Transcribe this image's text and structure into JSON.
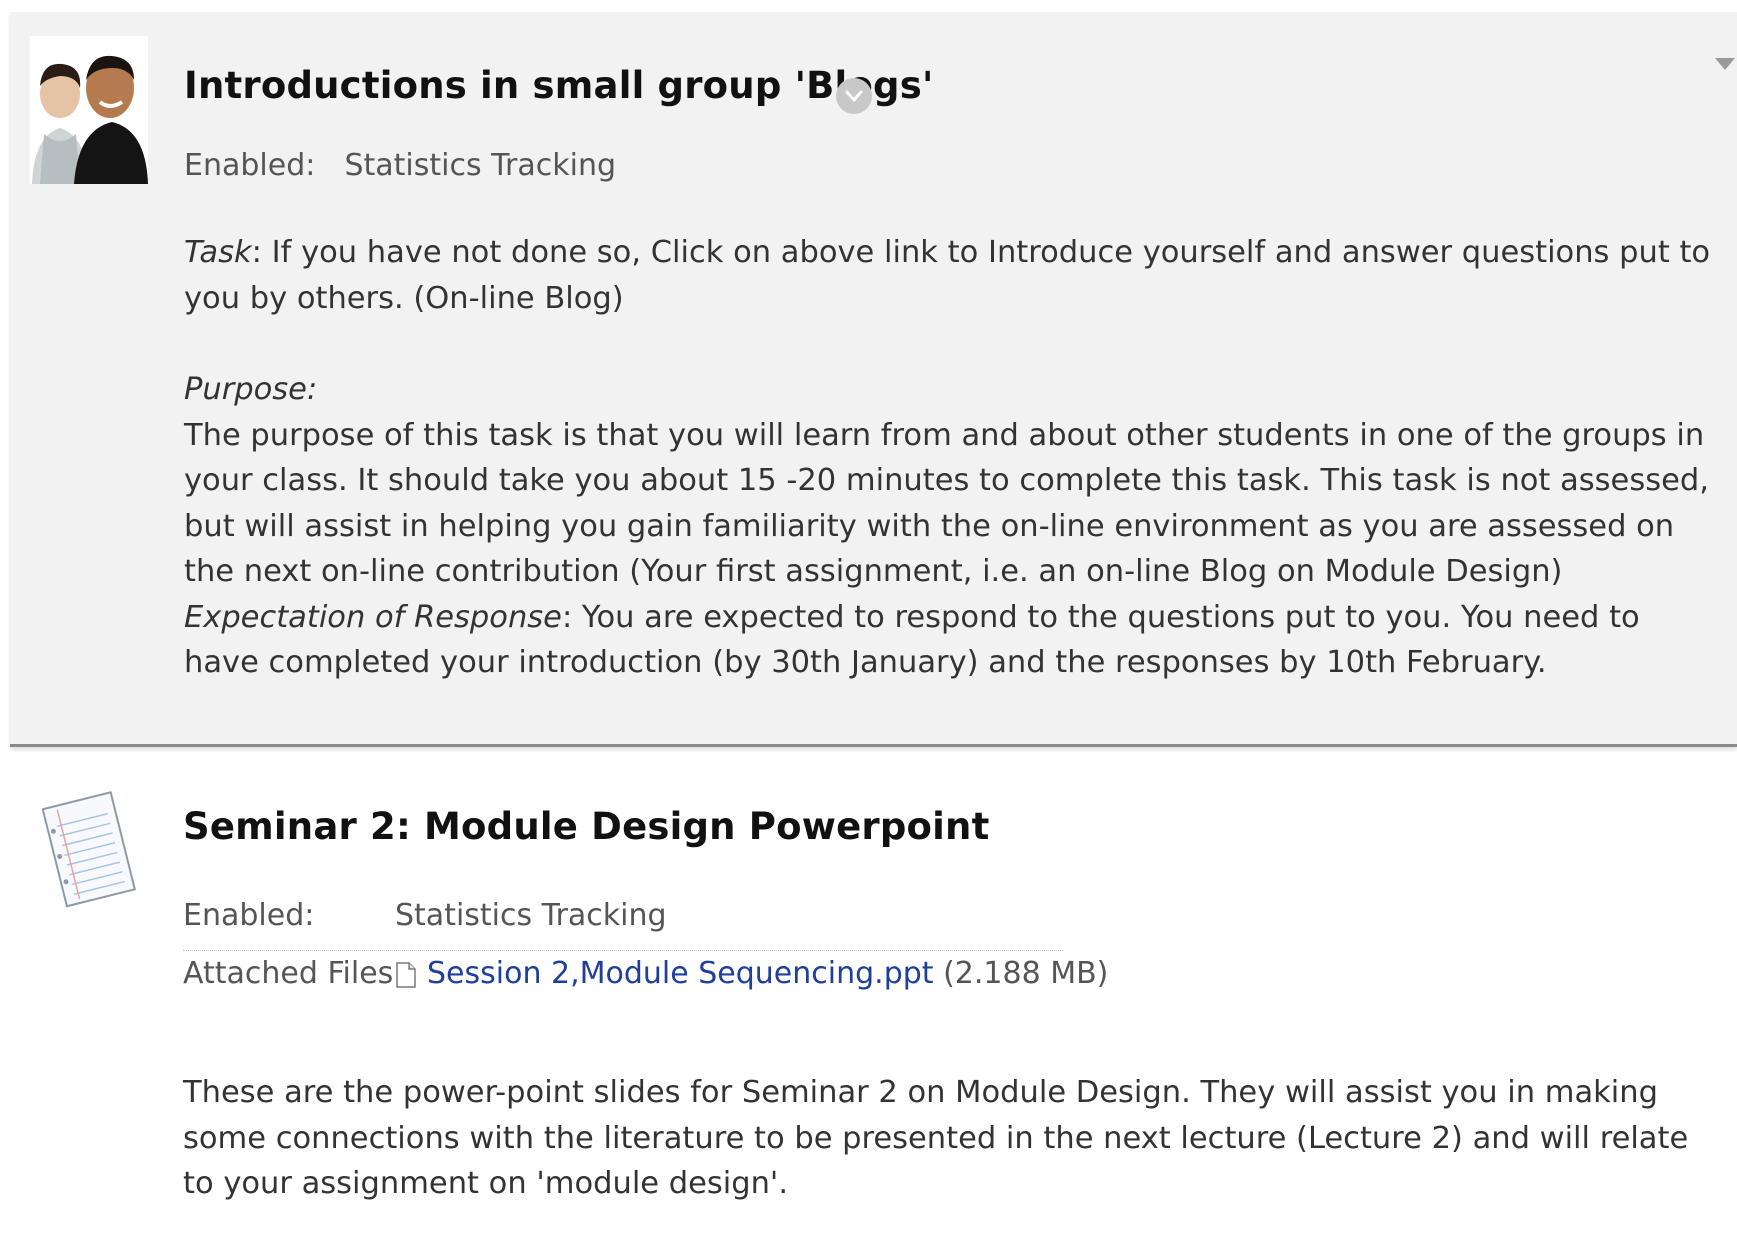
{
  "items": [
    {
      "title": "Introductions in small group 'Blogs'",
      "enabled_label": "Enabled:",
      "enabled_value": "Statistics Tracking",
      "task_label": "Task",
      "task_text": ": If you have not done so, Click on above link to Introduce yourself and answer questions put to you by others. (On-line Blog)",
      "purpose_label": "Purpose:",
      "purpose_text": "The purpose of this task is that you will learn from and about other students in one of the groups in your class. It should take you about 15 -20 minutes to complete this task. This task is not assessed, but will assist in helping you gain familiarity with the on-line environment as you are assessed on the next on-line contribution (Your first assignment, i.e. an on-line Blog on Module Design)",
      "expectation_label": "Expectation of Response",
      "expectation_text": ": You are expected to respond to the questions put to you. You need to have completed your introduction (by 30th January) and the responses by 10th February.",
      "icons": [
        "avatar-image",
        "options-chevron-icon",
        "menu-arrow-icon"
      ]
    },
    {
      "title": "Seminar 2: Module Design Powerpoint",
      "enabled_label": "Enabled:",
      "enabled_value": "Statistics Tracking",
      "files_label": "Attached Files:",
      "file_name": "Session 2,Module Sequencing.ppt",
      "file_size": "(2.188 MB)",
      "description": "These are the power-point slides for Seminar 2 on Module Design. They will assist you in making some connections with the literature to be presented in the next lecture (Lecture 2) and will relate to your assignment on 'module design'.",
      "icons": [
        "document-icon",
        "file-icon"
      ]
    }
  ],
  "colors": {
    "item_highlight_bg": "#f2f2f2",
    "link": "#1f3f9a",
    "title": "#111111",
    "body_text": "#333333",
    "meta_text": "#555555"
  }
}
